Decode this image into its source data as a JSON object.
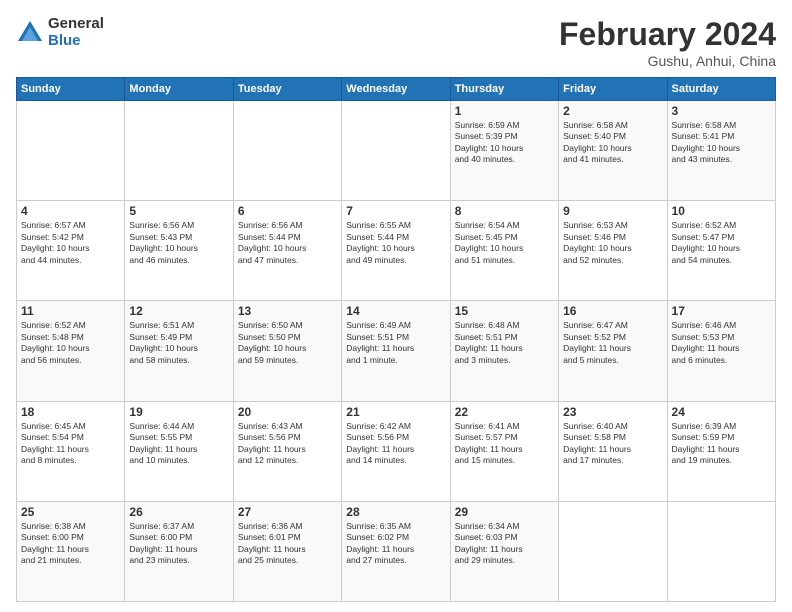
{
  "logo": {
    "general": "General",
    "blue": "Blue"
  },
  "title": "February 2024",
  "subtitle": "Gushu, Anhui, China",
  "weekdays": [
    "Sunday",
    "Monday",
    "Tuesday",
    "Wednesday",
    "Thursday",
    "Friday",
    "Saturday"
  ],
  "weeks": [
    [
      {
        "day": "",
        "info": ""
      },
      {
        "day": "",
        "info": ""
      },
      {
        "day": "",
        "info": ""
      },
      {
        "day": "",
        "info": ""
      },
      {
        "day": "1",
        "info": "Sunrise: 6:59 AM\nSunset: 5:39 PM\nDaylight: 10 hours\nand 40 minutes."
      },
      {
        "day": "2",
        "info": "Sunrise: 6:58 AM\nSunset: 5:40 PM\nDaylight: 10 hours\nand 41 minutes."
      },
      {
        "day": "3",
        "info": "Sunrise: 6:58 AM\nSunset: 5:41 PM\nDaylight: 10 hours\nand 43 minutes."
      }
    ],
    [
      {
        "day": "4",
        "info": "Sunrise: 6:57 AM\nSunset: 5:42 PM\nDaylight: 10 hours\nand 44 minutes."
      },
      {
        "day": "5",
        "info": "Sunrise: 6:56 AM\nSunset: 5:43 PM\nDaylight: 10 hours\nand 46 minutes."
      },
      {
        "day": "6",
        "info": "Sunrise: 6:56 AM\nSunset: 5:44 PM\nDaylight: 10 hours\nand 47 minutes."
      },
      {
        "day": "7",
        "info": "Sunrise: 6:55 AM\nSunset: 5:44 PM\nDaylight: 10 hours\nand 49 minutes."
      },
      {
        "day": "8",
        "info": "Sunrise: 6:54 AM\nSunset: 5:45 PM\nDaylight: 10 hours\nand 51 minutes."
      },
      {
        "day": "9",
        "info": "Sunrise: 6:53 AM\nSunset: 5:46 PM\nDaylight: 10 hours\nand 52 minutes."
      },
      {
        "day": "10",
        "info": "Sunrise: 6:52 AM\nSunset: 5:47 PM\nDaylight: 10 hours\nand 54 minutes."
      }
    ],
    [
      {
        "day": "11",
        "info": "Sunrise: 6:52 AM\nSunset: 5:48 PM\nDaylight: 10 hours\nand 56 minutes."
      },
      {
        "day": "12",
        "info": "Sunrise: 6:51 AM\nSunset: 5:49 PM\nDaylight: 10 hours\nand 58 minutes."
      },
      {
        "day": "13",
        "info": "Sunrise: 6:50 AM\nSunset: 5:50 PM\nDaylight: 10 hours\nand 59 minutes."
      },
      {
        "day": "14",
        "info": "Sunrise: 6:49 AM\nSunset: 5:51 PM\nDaylight: 11 hours\nand 1 minute."
      },
      {
        "day": "15",
        "info": "Sunrise: 6:48 AM\nSunset: 5:51 PM\nDaylight: 11 hours\nand 3 minutes."
      },
      {
        "day": "16",
        "info": "Sunrise: 6:47 AM\nSunset: 5:52 PM\nDaylight: 11 hours\nand 5 minutes."
      },
      {
        "day": "17",
        "info": "Sunrise: 6:46 AM\nSunset: 5:53 PM\nDaylight: 11 hours\nand 6 minutes."
      }
    ],
    [
      {
        "day": "18",
        "info": "Sunrise: 6:45 AM\nSunset: 5:54 PM\nDaylight: 11 hours\nand 8 minutes."
      },
      {
        "day": "19",
        "info": "Sunrise: 6:44 AM\nSunset: 5:55 PM\nDaylight: 11 hours\nand 10 minutes."
      },
      {
        "day": "20",
        "info": "Sunrise: 6:43 AM\nSunset: 5:56 PM\nDaylight: 11 hours\nand 12 minutes."
      },
      {
        "day": "21",
        "info": "Sunrise: 6:42 AM\nSunset: 5:56 PM\nDaylight: 11 hours\nand 14 minutes."
      },
      {
        "day": "22",
        "info": "Sunrise: 6:41 AM\nSunset: 5:57 PM\nDaylight: 11 hours\nand 15 minutes."
      },
      {
        "day": "23",
        "info": "Sunrise: 6:40 AM\nSunset: 5:58 PM\nDaylight: 11 hours\nand 17 minutes."
      },
      {
        "day": "24",
        "info": "Sunrise: 6:39 AM\nSunset: 5:59 PM\nDaylight: 11 hours\nand 19 minutes."
      }
    ],
    [
      {
        "day": "25",
        "info": "Sunrise: 6:38 AM\nSunset: 6:00 PM\nDaylight: 11 hours\nand 21 minutes."
      },
      {
        "day": "26",
        "info": "Sunrise: 6:37 AM\nSunset: 6:00 PM\nDaylight: 11 hours\nand 23 minutes."
      },
      {
        "day": "27",
        "info": "Sunrise: 6:36 AM\nSunset: 6:01 PM\nDaylight: 11 hours\nand 25 minutes."
      },
      {
        "day": "28",
        "info": "Sunrise: 6:35 AM\nSunset: 6:02 PM\nDaylight: 11 hours\nand 27 minutes."
      },
      {
        "day": "29",
        "info": "Sunrise: 6:34 AM\nSunset: 6:03 PM\nDaylight: 11 hours\nand 29 minutes."
      },
      {
        "day": "",
        "info": ""
      },
      {
        "day": "",
        "info": ""
      }
    ]
  ]
}
